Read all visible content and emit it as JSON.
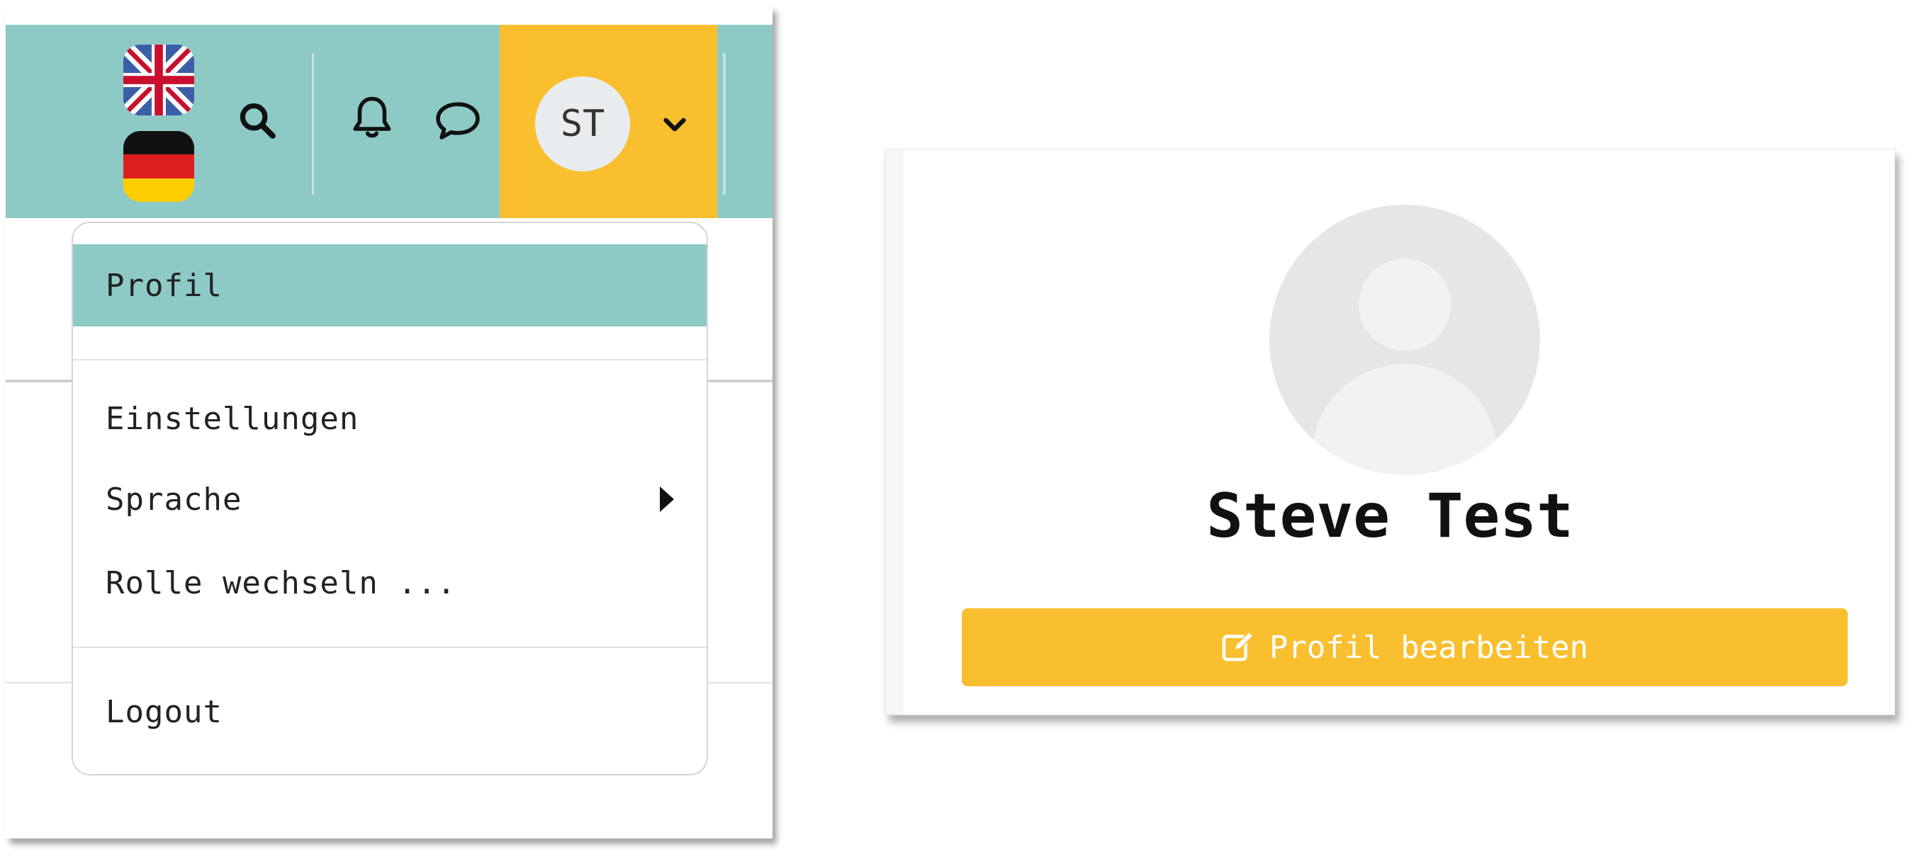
{
  "header": {
    "languages": [
      {
        "name": "English",
        "icon": "uk-flag-icon"
      },
      {
        "name": "Deutsch",
        "icon": "german-flag-icon"
      }
    ],
    "icons": [
      "search-icon",
      "bell-icon",
      "chat-icon",
      "chevron-down-icon"
    ],
    "user_initials": "ST"
  },
  "user_menu": {
    "items": [
      {
        "label": "Profil",
        "active": true
      },
      {
        "label": "Einstellungen"
      },
      {
        "label": "Sprache",
        "has_submenu": true
      },
      {
        "label": "Rolle wechseln ..."
      },
      {
        "label": "Logout"
      }
    ]
  },
  "profile": {
    "name": "Steve Test",
    "edit_label": "Profil bearbeiten",
    "edit_icon": "edit-icon"
  },
  "colors": {
    "header_teal": "#8ecac5",
    "accent_yellow": "#f9bf2e",
    "avatar_grey": "#e9ecef"
  }
}
